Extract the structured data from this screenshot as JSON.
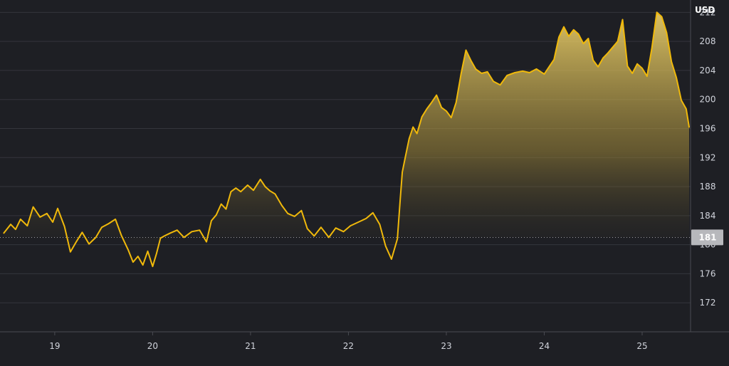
{
  "chart_data": {
    "type": "area",
    "currency_label": "USD",
    "x_tick_labels": [
      "19",
      "20",
      "21",
      "22",
      "23",
      "24",
      "25"
    ],
    "x_tick_days": [
      19,
      20,
      21,
      22,
      23,
      24,
      25
    ],
    "x_range": [
      18.47,
      25.48
    ],
    "y_ticks": [
      172,
      176,
      180,
      184,
      188,
      192,
      196,
      200,
      204,
      208,
      212
    ],
    "ylim": [
      168,
      213.7
    ],
    "grid": true,
    "reference_value": 181,
    "current_price_label": "181",
    "colors": {
      "background": "#1e1f24",
      "line": "#f0b90b",
      "area_top": "#f0d36b",
      "reference_line": "#9a9aa0",
      "price_badge": "#b7b8bc"
    },
    "x": [
      18.48,
      18.55,
      18.6,
      18.65,
      18.72,
      18.78,
      18.85,
      18.92,
      18.98,
      19.03,
      19.1,
      19.16,
      19.22,
      19.28,
      19.35,
      19.42,
      19.48,
      19.55,
      19.62,
      19.68,
      19.75,
      19.8,
      19.85,
      19.9,
      19.95,
      20.0,
      20.04,
      20.08,
      20.12,
      20.18,
      20.25,
      20.32,
      20.4,
      20.48,
      20.55,
      20.6,
      20.65,
      20.7,
      20.75,
      20.8,
      20.85,
      20.9,
      20.97,
      21.03,
      21.1,
      21.15,
      21.2,
      21.25,
      21.32,
      21.38,
      21.45,
      21.52,
      21.58,
      21.65,
      21.72,
      21.8,
      21.87,
      21.95,
      22.02,
      22.1,
      22.18,
      22.25,
      22.32,
      22.38,
      22.44,
      22.5,
      22.53,
      22.55,
      22.58,
      22.62,
      22.66,
      22.7,
      22.75,
      22.8,
      22.85,
      22.9,
      22.95,
      23.0,
      23.05,
      23.1,
      23.15,
      23.2,
      23.25,
      23.3,
      23.36,
      23.42,
      23.48,
      23.55,
      23.62,
      23.7,
      23.78,
      23.85,
      23.92,
      24.0,
      24.05,
      24.1,
      24.15,
      24.2,
      24.25,
      24.3,
      24.35,
      24.4,
      24.45,
      24.5,
      24.55,
      24.6,
      24.65,
      24.7,
      24.75,
      24.8,
      24.85,
      24.9,
      24.95,
      25.0,
      25.05,
      25.1,
      25.15,
      25.2,
      25.25,
      25.3,
      25.35,
      25.4,
      25.45,
      25.48
    ],
    "values": [
      181.6,
      182.8,
      182.1,
      183.5,
      182.6,
      185.2,
      183.8,
      184.3,
      183.1,
      185.0,
      182.5,
      179.0,
      180.4,
      181.7,
      180.1,
      181.0,
      182.4,
      182.9,
      183.5,
      181.3,
      179.3,
      177.6,
      178.4,
      177.2,
      179.1,
      177.0,
      178.8,
      180.9,
      181.2,
      181.6,
      182.0,
      181.0,
      181.8,
      182.0,
      180.4,
      183.3,
      184.1,
      185.6,
      184.9,
      187.3,
      187.8,
      187.3,
      188.2,
      187.5,
      189.0,
      188.0,
      187.4,
      187.0,
      185.4,
      184.3,
      183.9,
      184.7,
      182.2,
      181.2,
      182.4,
      181.0,
      182.3,
      181.8,
      182.6,
      183.1,
      183.6,
      184.4,
      182.8,
      179.8,
      178.0,
      180.8,
      186.4,
      190.0,
      192.0,
      194.6,
      196.2,
      195.3,
      197.6,
      198.7,
      199.6,
      200.6,
      198.9,
      198.4,
      197.5,
      199.6,
      203.5,
      206.8,
      205.4,
      204.2,
      203.6,
      203.8,
      202.5,
      202.0,
      203.3,
      203.7,
      203.9,
      203.7,
      204.2,
      203.5,
      204.5,
      205.5,
      208.6,
      210.0,
      208.7,
      209.6,
      209.0,
      207.7,
      208.4,
      205.4,
      204.5,
      205.7,
      206.4,
      207.2,
      208.0,
      211.0,
      204.6,
      203.6,
      204.9,
      204.3,
      203.2,
      207.1,
      212.0,
      211.4,
      209.2,
      205.2,
      203.0,
      199.9,
      198.7,
      196.2
    ]
  }
}
